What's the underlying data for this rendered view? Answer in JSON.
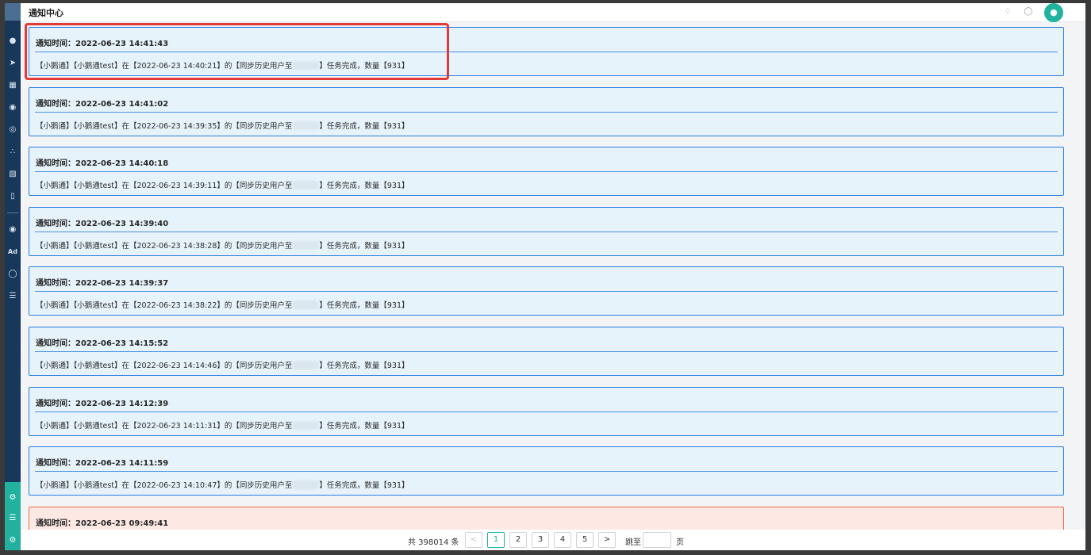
{
  "header": {
    "title": "通知中心",
    "icons": [
      "bell-icon",
      "chat-icon",
      "user-avatar-icon"
    ]
  },
  "sidebar": {
    "items": [
      "dashboard-icon",
      "send-icon",
      "table-icon",
      "user-icon",
      "users-icon",
      "group-icon",
      "bookmark-icon",
      "chart-icon",
      "wechat-icon",
      "Ad",
      "circle-icon",
      "list-icon"
    ],
    "bottom_items": [
      "settings-icon",
      "menu-icon",
      "gear-icon"
    ]
  },
  "notices": [
    {
      "time_label": "通知时间：2022-06-23 14:41:43",
      "msg_before": "【小鹅通】【小鹅通test】在【2022-06-23 14:40:21】的【同步历史用户至",
      "msg_after": "】任务完成，数量【931】",
      "status": "info"
    },
    {
      "time_label": "通知时间：2022-06-23 14:41:02",
      "msg_before": "【小鹅通】【小鹅通test】在【2022-06-23 14:39:35】的【同步历史用户至",
      "msg_after": "】任务完成，数量【931】",
      "status": "info"
    },
    {
      "time_label": "通知时间：2022-06-23 14:40:18",
      "msg_before": "【小鹅通】【小鹅通test】在【2022-06-23 14:39:11】的【同步历史用户至",
      "msg_after": "】任务完成，数量【931】",
      "status": "info"
    },
    {
      "time_label": "通知时间：2022-06-23 14:39:40",
      "msg_before": "【小鹅通】【小鹅通test】在【2022-06-23 14:38:28】的【同步历史用户至",
      "msg_after": "】任务完成，数量【931】",
      "status": "info"
    },
    {
      "time_label": "通知时间：2022-06-23 14:39:37",
      "msg_before": "【小鹅通】【小鹅通test】在【2022-06-23 14:38:22】的【同步历史用户至",
      "msg_after": "】任务完成，数量【931】",
      "status": "info"
    },
    {
      "time_label": "通知时间：2022-06-23 14:15:52",
      "msg_before": "【小鹅通】【小鹅通test】在【2022-06-23 14:14:46】的【同步历史用户至",
      "msg_after": "】任务完成，数量【931】",
      "status": "info"
    },
    {
      "time_label": "通知时间：2022-06-23 14:12:39",
      "msg_before": "【小鹅通】【小鹅通test】在【2022-06-23 14:11:31】的【同步历史用户至",
      "msg_after": "】任务完成，数量【931】",
      "status": "info"
    },
    {
      "time_label": "通知时间：2022-06-23 14:11:59",
      "msg_before": "【小鹅通】【小鹅通test】在【2022-06-23 14:10:47】的【同步历史用户至",
      "msg_after": "】任务完成，数量【931】",
      "status": "info"
    },
    {
      "time_label": "通知时间：2022-06-23 09:49:41",
      "msg_before": "",
      "msg_after": "",
      "status": "error"
    }
  ],
  "pagination": {
    "total_text": "共 398014 条",
    "prev": "<",
    "pages": [
      "1",
      "2",
      "3",
      "4",
      "5"
    ],
    "current_page": "1",
    "next": ">",
    "jump_label": "跳至",
    "page_unit": "页"
  },
  "colors": {
    "sidebar": "#17385a",
    "accent": "#21b3a0",
    "card_border": "#2a7de1",
    "card_bg": "#e6f3fb",
    "error_border": "#ef6a4c",
    "error_bg": "#fde8e4",
    "highlight": "#e53935"
  }
}
